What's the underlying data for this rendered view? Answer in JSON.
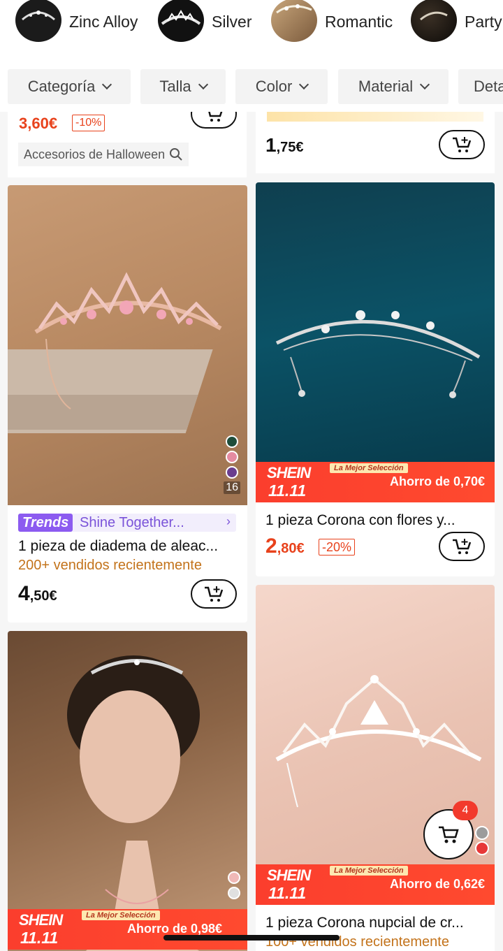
{
  "categories": [
    {
      "label": "Zinc Alloy",
      "icon": "tiara-thumbnail"
    },
    {
      "label": "Silver",
      "icon": "tiara-thumbnail"
    },
    {
      "label": "Romantic",
      "icon": "hair-thumbnail"
    },
    {
      "label": "Party",
      "icon": "party-thumbnail"
    }
  ],
  "filters": [
    "Categoría",
    "Talla",
    "Color",
    "Material",
    "Deta"
  ],
  "top_cards": {
    "left": {
      "price_big": "3,60€",
      "discount": "-10%",
      "search_hint": "Accesorios de Halloween"
    },
    "right": {
      "price_int": "1",
      "price_dec": ",75€"
    }
  },
  "products": [
    {
      "trends_badge": "Trends",
      "trends_text": "Shine Together...",
      "title": "1 pieza de diadema de aleac...",
      "sold": "200+ vendidos recientemente",
      "price_int": "4",
      "price_dec": ",50€",
      "swatch_count": "16"
    },
    {
      "banner_logo": "SHEIN",
      "banner_event": "11.11",
      "banner_tag": "La Mejor Selección",
      "banner_save": "Ahorro de 0,70€",
      "title": "1 pieza Corona con flores y...",
      "price_int": "2",
      "price_dec": ",80€",
      "discount": "-20%"
    },
    {
      "banner_logo": "SHEIN",
      "banner_event": "11.11",
      "banner_tag": "La Mejor Selección",
      "banner_save": "Ahorro de 0,62€",
      "title": "1 pieza Corona nupcial de cr...",
      "sold": "100+ vendidos recientemente"
    },
    {
      "banner_logo": "SHEIN",
      "banner_event": "11.11",
      "banner_tag": "La Mejor Selección",
      "banner_save": "Ahorro de 0,98€"
    }
  ],
  "floating_cart": {
    "badge": "4"
  },
  "colors": {
    "accent_red": "#e8421c",
    "sold_orange": "#c3731b",
    "trends_purple": "#8c5bf0"
  }
}
